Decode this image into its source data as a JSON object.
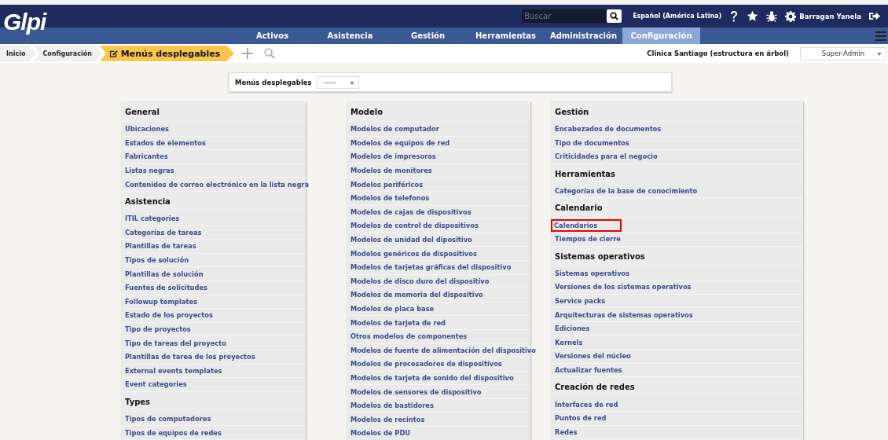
{
  "header": {
    "logo": "Glpi",
    "search": {
      "placeholder": "Buscar"
    },
    "language": "Español (América Latina)",
    "user": "Barragan Yanela"
  },
  "menu": [
    {
      "label": "Activos",
      "selected": false
    },
    {
      "label": "Asistencia",
      "selected": false
    },
    {
      "label": "Gestión",
      "selected": false
    },
    {
      "label": "Herramientas",
      "selected": false
    },
    {
      "label": "Administración",
      "selected": false
    },
    {
      "label": "Configuración",
      "selected": true
    }
  ],
  "breadcrumb": [
    {
      "label": "Inicio",
      "current": false
    },
    {
      "label": "Configuración",
      "current": false
    },
    {
      "label": "Menús desplegables",
      "current": true
    }
  ],
  "entity": "Clinica Santiago (estructura en árbol)",
  "profile": "Super-Admin",
  "selector": {
    "label": "Menús desplegables",
    "value": "-----"
  },
  "columns": [
    {
      "groups": [
        {
          "title": "General",
          "items": [
            {
              "label": "Ubicaciones",
              "outlined": false
            },
            {
              "label": "Estados de elementos",
              "outlined": false
            },
            {
              "label": "Fabricantes",
              "outlined": false
            },
            {
              "label": "Listas negras",
              "outlined": false
            },
            {
              "label": "Contenidos de correo electrónico en la lista negra",
              "outlined": false
            }
          ]
        },
        {
          "title": "Asistencia",
          "items": [
            {
              "label": "ITIL categories",
              "outlined": false
            },
            {
              "label": "Categorías de tareas",
              "outlined": false
            },
            {
              "label": "Plantillas de tareas",
              "outlined": false
            },
            {
              "label": "Tipos de solución",
              "outlined": false
            },
            {
              "label": "Plantillas de solución",
              "outlined": false
            },
            {
              "label": "Fuentes de solicitudes",
              "outlined": false
            },
            {
              "label": "Followup templates",
              "outlined": false
            },
            {
              "label": "Estado de los proyectos",
              "outlined": false
            },
            {
              "label": "Tipo de proyectos",
              "outlined": false
            },
            {
              "label": "Tipo de tareas del proyecto",
              "outlined": false
            },
            {
              "label": "Plantillas de tarea de los proyectos",
              "outlined": false
            },
            {
              "label": "External events templates",
              "outlined": false
            },
            {
              "label": "Event categories",
              "outlined": false
            }
          ]
        },
        {
          "title": "Types",
          "items": [
            {
              "label": "Tipos de computadores",
              "outlined": false
            },
            {
              "label": "Tipos de equipos de redes",
              "outlined": false
            }
          ]
        }
      ]
    },
    {
      "groups": [
        {
          "title": "Modelo",
          "items": [
            {
              "label": "Modelos de computador",
              "outlined": false
            },
            {
              "label": "Modelos de equipos de red",
              "outlined": false
            },
            {
              "label": "Modelos de impresoras",
              "outlined": false
            },
            {
              "label": "Modelos de monitores",
              "outlined": false
            },
            {
              "label": "Modelos periféricos",
              "outlined": false
            },
            {
              "label": "Modelos de telefonos",
              "outlined": false
            },
            {
              "label": "Modelos de cajas de dispositivos",
              "outlined": false
            },
            {
              "label": "Modelos de control de dispositivos",
              "outlined": false
            },
            {
              "label": "Modelos de unidad del dipositivo",
              "outlined": false
            },
            {
              "label": "Modelos genéricos de dispositivos",
              "outlined": false
            },
            {
              "label": "Modelos de tarjetas gráficas del dispositivo",
              "outlined": false
            },
            {
              "label": "Modelos de disco duro del dispositivo",
              "outlined": false
            },
            {
              "label": "Modelos de memoria del dispositivo",
              "outlined": false
            },
            {
              "label": "Modelos de placa base",
              "outlined": false
            },
            {
              "label": "Modelos de tarjeta de red",
              "outlined": false
            },
            {
              "label": "Otros modelos de componentes",
              "outlined": false
            },
            {
              "label": "Modelos de fuente de alimentación del dispositivo",
              "outlined": false
            },
            {
              "label": "Modelos de procesadores de dispositivos",
              "outlined": false
            },
            {
              "label": "Modelos de tarjeta de sonido del dispositivo",
              "outlined": false
            },
            {
              "label": "Modelos de sensores de dispositivo",
              "outlined": false
            },
            {
              "label": "Modelos de bastidores",
              "outlined": false
            },
            {
              "label": "Modelos de recintos",
              "outlined": false
            },
            {
              "label": "Modelos de PDU",
              "outlined": false
            }
          ]
        }
      ]
    },
    {
      "groups": [
        {
          "title": "Gestión",
          "items": [
            {
              "label": "Encabezados de documentos",
              "outlined": false
            },
            {
              "label": "Tipo de documentos",
              "outlined": false
            },
            {
              "label": "Criticidades para el negocio",
              "outlined": false
            }
          ]
        },
        {
          "title": "Herramientas",
          "items": [
            {
              "label": "Categorías de la base de conocimiento",
              "outlined": false
            }
          ]
        },
        {
          "title": "Calendario",
          "items": [
            {
              "label": "Calendarios",
              "outlined": true
            },
            {
              "label": "Tiempos de cierre",
              "outlined": false
            }
          ]
        },
        {
          "title": "Sistemas operativos",
          "items": [
            {
              "label": "Sistemas operativos",
              "outlined": false
            },
            {
              "label": "Versiones de los sistemas operativos",
              "outlined": false
            },
            {
              "label": "Service packs",
              "outlined": false
            },
            {
              "label": "Arquitecturas de sistemas operativos",
              "outlined": false
            },
            {
              "label": "Ediciones",
              "outlined": false
            },
            {
              "label": "Kernels",
              "outlined": false
            },
            {
              "label": "Versiones del núcleo",
              "outlined": false
            },
            {
              "label": "Actualizar fuentes",
              "outlined": false
            }
          ]
        },
        {
          "title": "Creación de redes",
          "items": [
            {
              "label": "Interfaces de red",
              "outlined": false
            },
            {
              "label": "Puntos de red",
              "outlined": false
            },
            {
              "label": "Redes",
              "outlined": false
            }
          ]
        }
      ]
    }
  ]
}
